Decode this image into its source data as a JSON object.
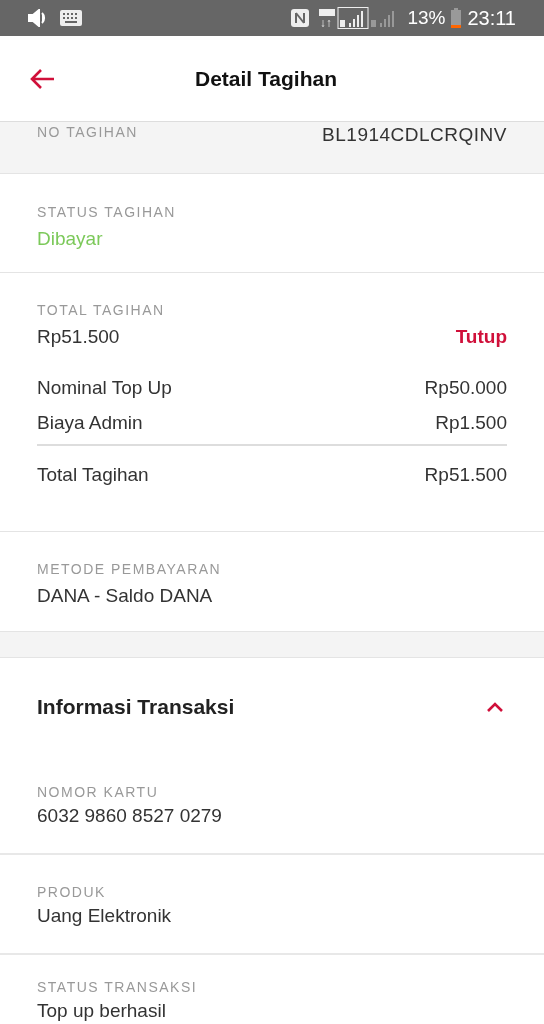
{
  "status_bar": {
    "battery": "13%",
    "time": "23:11"
  },
  "header": {
    "title": "Detail Tagihan"
  },
  "bill_number": {
    "label": "NO TAGIHAN",
    "value": "BL1914CDLCRQINV"
  },
  "bill_status": {
    "label": "STATUS TAGIHAN",
    "value": "Dibayar"
  },
  "bill_total": {
    "label": "TOTAL TAGIHAN",
    "value": "Rp51.500",
    "toggle": "Tutup",
    "expanded": true,
    "rows": [
      {
        "label": "Nominal Top Up",
        "value": "Rp50.000"
      },
      {
        "label": "Biaya Admin",
        "value": "Rp1.500"
      }
    ],
    "total": {
      "label": "Total Tagihan",
      "value": "Rp51.500"
    }
  },
  "payment_method": {
    "label": "METODE PEMBAYARAN",
    "value": "DANA - Saldo DANA"
  },
  "transaction_info": {
    "title": "Informasi Transaksi",
    "expanded": true,
    "fields": [
      {
        "label": "NOMOR KARTU",
        "value": "6032 9860 8527 0279"
      },
      {
        "label": "PRODUK",
        "value": "Uang Elektronik"
      },
      {
        "label": "STATUS TRANSAKSI",
        "value": "Top up berhasil"
      }
    ]
  }
}
